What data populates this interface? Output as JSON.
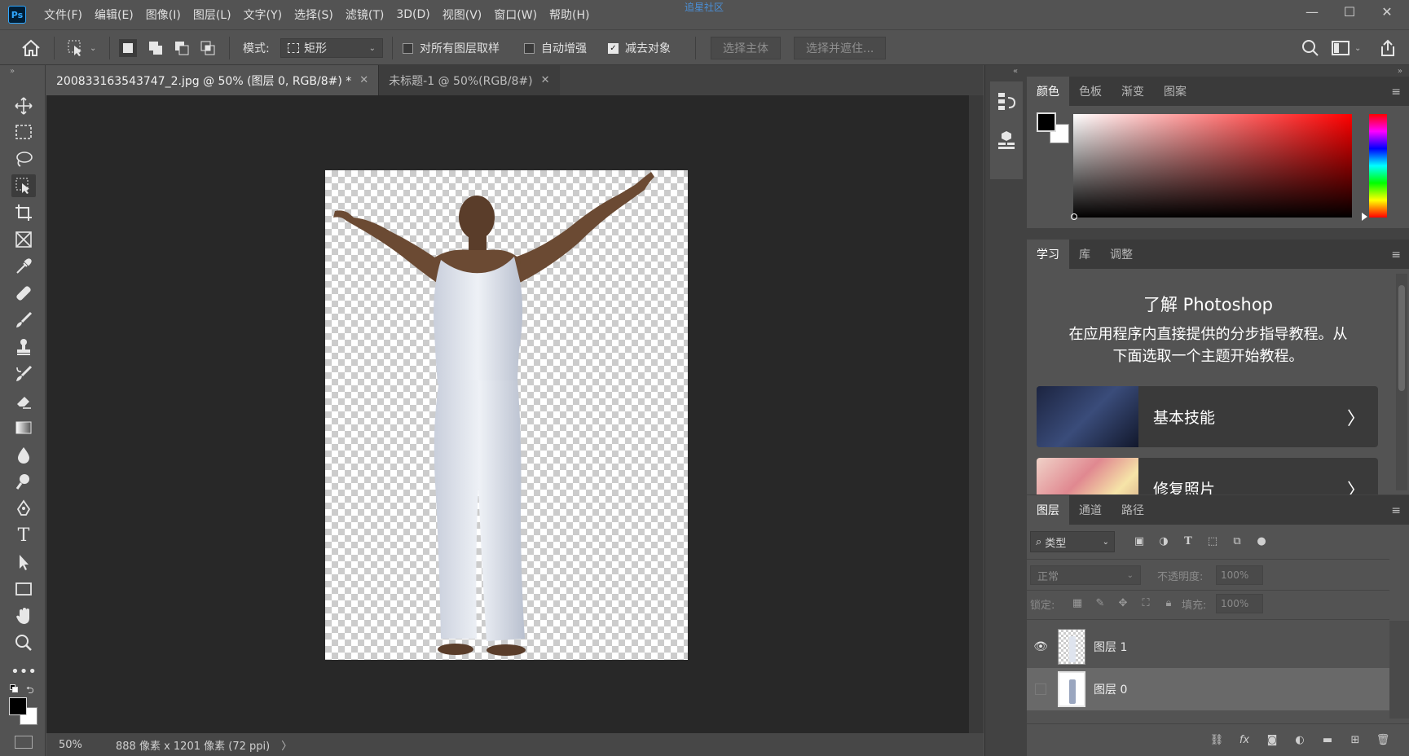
{
  "app": {
    "logo": "Ps",
    "watermark": "追星社区"
  },
  "menu": [
    "文件(F)",
    "编辑(E)",
    "图像(I)",
    "图层(L)",
    "文字(Y)",
    "选择(S)",
    "滤镜(T)",
    "3D(D)",
    "视图(V)",
    "窗口(W)",
    "帮助(H)"
  ],
  "window_controls": {
    "minimize": "—",
    "maximize": "☐",
    "close": "✕"
  },
  "options": {
    "mode_label": "模式:",
    "mode_value": "矩形",
    "sample_all_layers": {
      "label": "对所有图层取样",
      "checked": false
    },
    "auto_enhance": {
      "label": "自动增强",
      "checked": false
    },
    "subtract_object": {
      "label": "减去对象",
      "checked": true
    },
    "select_subject": "选择主体",
    "select_and_mask": "选择并遮住..."
  },
  "tabs": [
    {
      "title": "200833163543747_2.jpg @ 50% (图层 0, RGB/8#) *",
      "active": true
    },
    {
      "title": "未标题-1 @ 50%(RGB/8#)",
      "active": false
    }
  ],
  "status": {
    "zoom": "50%",
    "info": "888 像素 x 1201 像素 (72 ppi)",
    "arrow": "〉"
  },
  "color_panel": {
    "tabs": [
      "颜色",
      "色板",
      "渐变",
      "图案"
    ],
    "active": "颜色",
    "foreground": "#000000",
    "background": "#ffffff",
    "hue": "#ff0000"
  },
  "learn_panel": {
    "tabs": [
      "学习",
      "库",
      "调整"
    ],
    "active": "学习",
    "title": "了解 Photoshop",
    "description_line1": "在应用程序内直接提供的分步指导教程。从",
    "description_line2": "下面选取一个主题开始教程。",
    "cards": [
      "基本技能",
      "修复照片"
    ]
  },
  "layers_panel": {
    "tabs": [
      "图层",
      "通道",
      "路径"
    ],
    "active": "图层",
    "filter_label": "类型",
    "blend_mode": "正常",
    "opacity_label": "不透明度:",
    "opacity_value": "100%",
    "lock_label": "锁定:",
    "fill_label": "填充:",
    "fill_value": "100%",
    "layers": [
      {
        "name": "图层 1",
        "visible": true,
        "selected": false
      },
      {
        "name": "图层 0",
        "visible": false,
        "selected": true
      }
    ]
  }
}
